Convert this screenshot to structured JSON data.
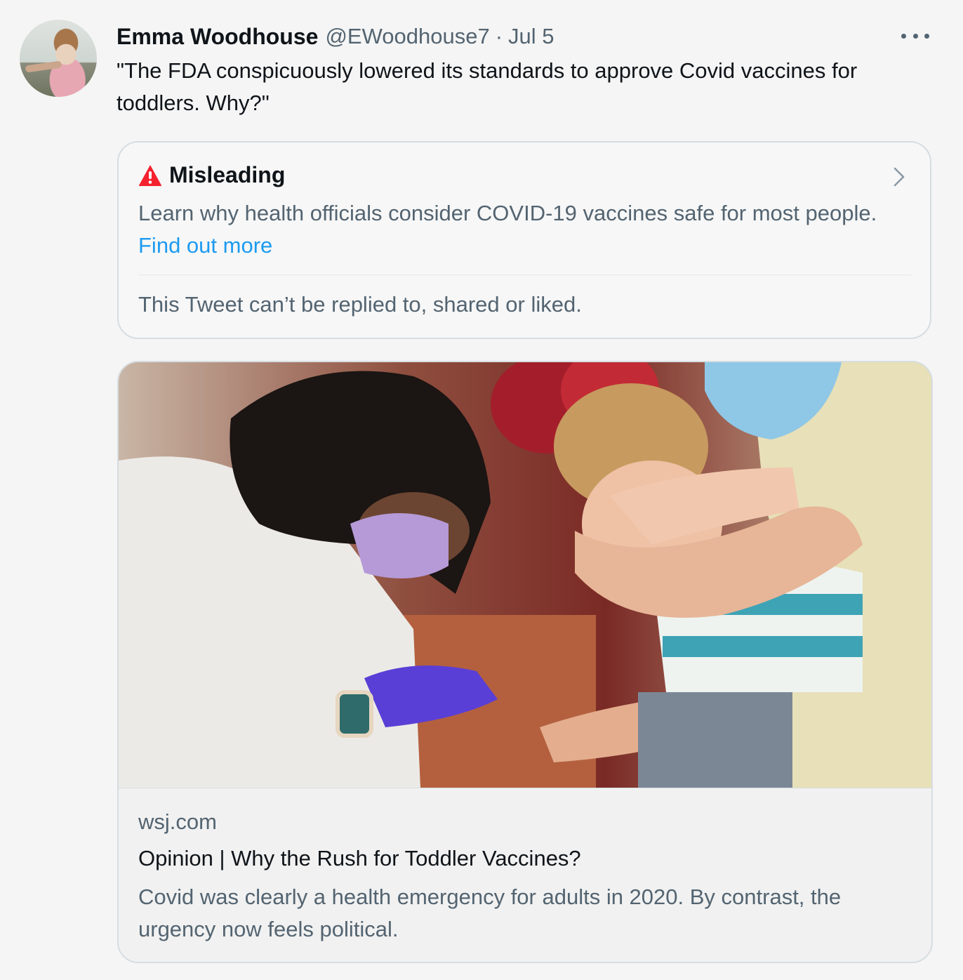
{
  "tweet": {
    "author_name": "Emma Woodhouse",
    "handle": "@EWoodhouse7",
    "separator": "·",
    "date": "Jul 5",
    "text": "\"The FDA conspicuously lowered its standards to approve Covid vaccines for toddlers. Why?\""
  },
  "notice": {
    "label": "Misleading",
    "body": "Learn why health officials consider COVID-19 vaccines safe for most people.",
    "link": "Find out more",
    "footer": "This Tweet can’t be replied to, shared or liked.",
    "warning_color": "#f4212e"
  },
  "card": {
    "domain": "wsj.com",
    "title": "Opinion | Why the Rush for Toddler Vaccines?",
    "description": "Covid was clearly a health emergency for adults in 2020. By contrast, the urgency now feels political."
  },
  "icons": {
    "more": "more-horizontal-icon",
    "warning": "warning-triangle-icon",
    "chevron": "chevron-right-icon"
  },
  "colors": {
    "link": "#1d9bf0",
    "secondary_text": "#536471",
    "primary_text": "#0f1419"
  }
}
